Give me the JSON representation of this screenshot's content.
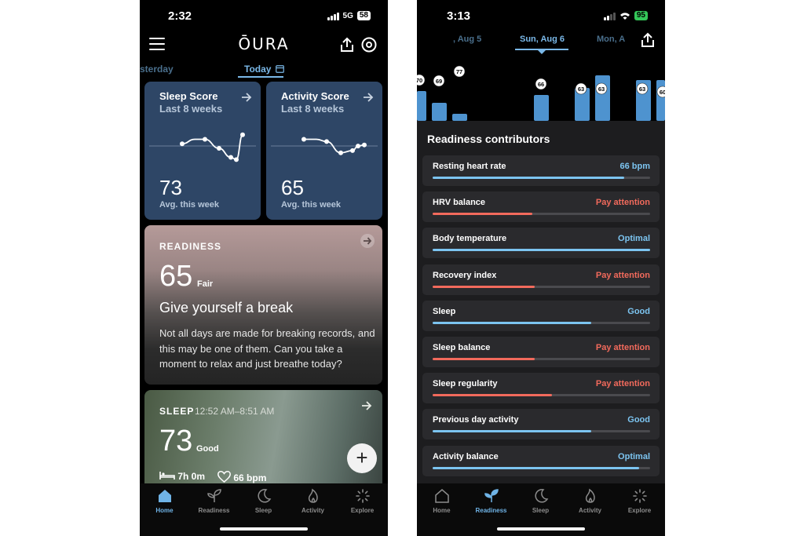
{
  "left_phone": {
    "status": {
      "time": "2:32",
      "network": "5G",
      "battery": "58"
    },
    "header": {
      "logo": "ŌURA",
      "menu_icon": "hamburger-icon",
      "share_icon": "share-icon",
      "ring_icon": "ring-icon"
    },
    "day_tabs": {
      "prev": "sterday",
      "today": "Today"
    },
    "sleep_score_card": {
      "title": "Sleep Score",
      "subtitle": "Last 8 weeks",
      "value": "73",
      "caption": "Avg. this week",
      "trend": [
        50,
        54,
        54,
        46,
        38,
        36,
        58
      ]
    },
    "activity_score_card": {
      "title": "Activity Score",
      "subtitle": "Last 8 weeks",
      "value": "65",
      "caption": "Avg. this week",
      "trend": [
        54,
        54,
        52,
        42,
        44,
        48,
        49
      ]
    },
    "readiness": {
      "label": "READINESS",
      "score": "65",
      "qualifier": "Fair",
      "headline": "Give yourself a break",
      "body": "Not all days are made for breaking records, and this may be one of them. Can you take a moment to relax and just breathe today?"
    },
    "sleep": {
      "label": "SLEEP",
      "time_range": "12:52 AM–8:51 AM",
      "score": "73",
      "qualifier": "Good",
      "duration": "7h 0m",
      "heart_rate": "66 bpm"
    },
    "fab_label": "+",
    "nav": [
      {
        "label": "Home",
        "icon": "home-icon",
        "active": true
      },
      {
        "label": "Readiness",
        "icon": "readiness-icon",
        "active": false
      },
      {
        "label": "Sleep",
        "icon": "moon-icon",
        "active": false
      },
      {
        "label": "Activity",
        "icon": "flame-icon",
        "active": false
      },
      {
        "label": "Explore",
        "icon": "explore-icon",
        "active": false
      }
    ]
  },
  "right_phone": {
    "status": {
      "time": "3:13",
      "battery": "95"
    },
    "dates": {
      "prev": ", Aug 5",
      "current": "Sun, Aug 6",
      "next": "Mon, A"
    },
    "chart_data": {
      "type": "bar",
      "bar_values": [
        70,
        69,
        77,
        66,
        63,
        63,
        63,
        60
      ],
      "labels": [
        "70",
        "69",
        "77",
        "66",
        "63",
        "63",
        "63",
        "60"
      ]
    },
    "contributors_title": "Readiness contributors",
    "contributors": [
      {
        "name": "Resting heart rate",
        "status": "66 bpm",
        "level": 0.88,
        "color": "#7cc4f0",
        "status_color": "#7cc4f0"
      },
      {
        "name": "HRV balance",
        "status": "Pay attention",
        "level": 0.46,
        "color": "#f26a5c",
        "status_color": "#f26a5c"
      },
      {
        "name": "Body temperature",
        "status": "Optimal",
        "level": 1.0,
        "color": "#7cc4f0",
        "status_color": "#7cc4f0"
      },
      {
        "name": "Recovery index",
        "status": "Pay attention",
        "level": 0.47,
        "color": "#f26a5c",
        "status_color": "#f26a5c"
      },
      {
        "name": "Sleep",
        "status": "Good",
        "level": 0.73,
        "color": "#7cc4f0",
        "status_color": "#7cc4f0"
      },
      {
        "name": "Sleep balance",
        "status": "Pay attention",
        "level": 0.47,
        "color": "#f26a5c",
        "status_color": "#f26a5c"
      },
      {
        "name": "Sleep regularity",
        "status": "Pay attention",
        "level": 0.55,
        "color": "#f26a5c",
        "status_color": "#f26a5c"
      },
      {
        "name": "Previous day activity",
        "status": "Good",
        "level": 0.73,
        "color": "#7cc4f0",
        "status_color": "#7cc4f0"
      },
      {
        "name": "Activity balance",
        "status": "Optimal",
        "level": 0.95,
        "color": "#7cc4f0",
        "status_color": "#7cc4f0"
      }
    ],
    "nav": [
      {
        "label": "Home",
        "icon": "home-icon",
        "active": false
      },
      {
        "label": "Readiness",
        "icon": "readiness-icon",
        "active": true
      },
      {
        "label": "Sleep",
        "icon": "moon-icon",
        "active": false
      },
      {
        "label": "Activity",
        "icon": "flame-icon",
        "active": false
      },
      {
        "label": "Explore",
        "icon": "explore-icon",
        "active": false
      }
    ]
  }
}
